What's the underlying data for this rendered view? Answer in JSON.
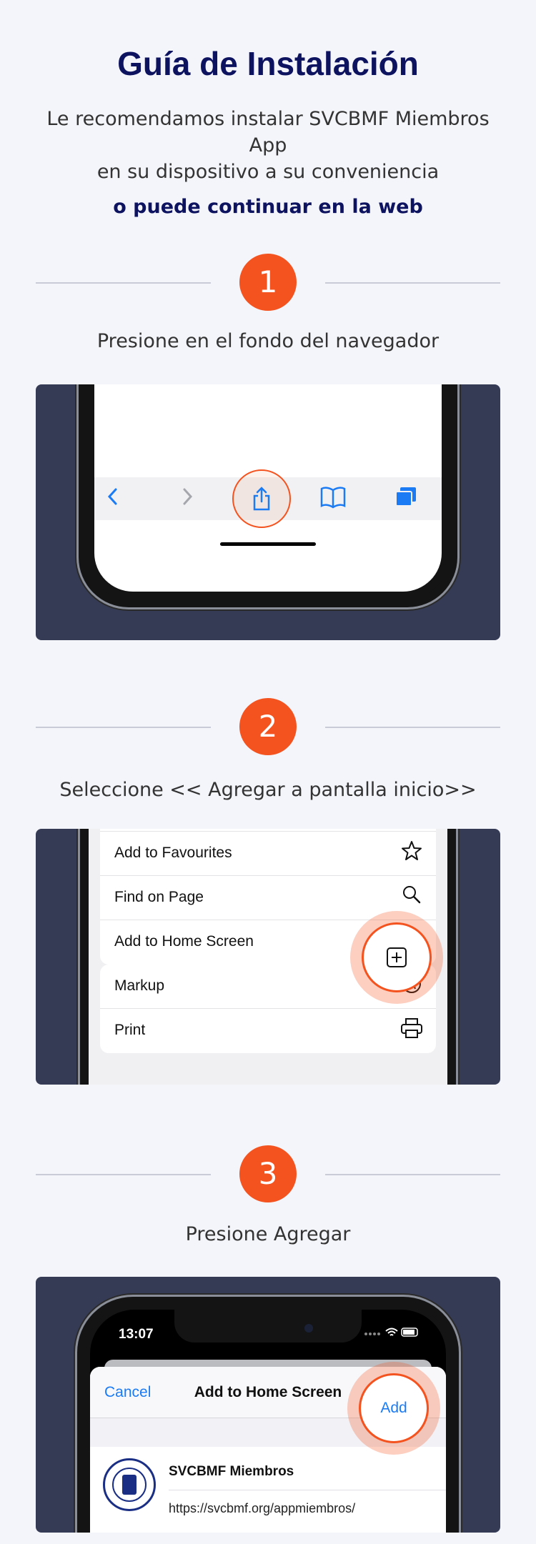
{
  "header": {
    "title": "Guía de Instalación",
    "subtitle_line1": "Le recomendamos instalar SVCBMF Miembros App",
    "subtitle_line2": "en su dispositivo a su conveniencia",
    "web_link": "o puede continuar en la web"
  },
  "steps": [
    {
      "number": "1",
      "instruction": "Presione en el fondo del navegador"
    },
    {
      "number": "2",
      "instruction": "Seleccione << Agregar a pantalla inicio>>"
    },
    {
      "number": "3",
      "instruction": "Presione Agregar"
    }
  ],
  "step1_toolbar": {
    "icons": [
      "back-chevron-icon",
      "forward-chevron-icon",
      "share-icon",
      "bookmarks-icon",
      "tabs-icon"
    ]
  },
  "step2_sheet": {
    "group1": [
      {
        "label": "Add to Favourites",
        "icon": "star-icon"
      },
      {
        "label": "Find on Page",
        "icon": "search-icon"
      },
      {
        "label": "Add to Home Screen",
        "icon": "plus-square-icon"
      }
    ],
    "group2": [
      {
        "label": "Markup",
        "icon": "markup-icon"
      },
      {
        "label": "Print",
        "icon": "printer-icon"
      }
    ]
  },
  "step3_sheet": {
    "time": "13:07",
    "cancel": "Cancel",
    "title": "Add to Home Screen",
    "add": "Add",
    "app_name": "SVCBMF Miembros",
    "app_url": "https://svcbmf.org/appmiembros/"
  },
  "colors": {
    "accent": "#f4531f",
    "title": "#0e1360",
    "panel": "#353b55",
    "ios_blue": "#1b7bf5"
  }
}
